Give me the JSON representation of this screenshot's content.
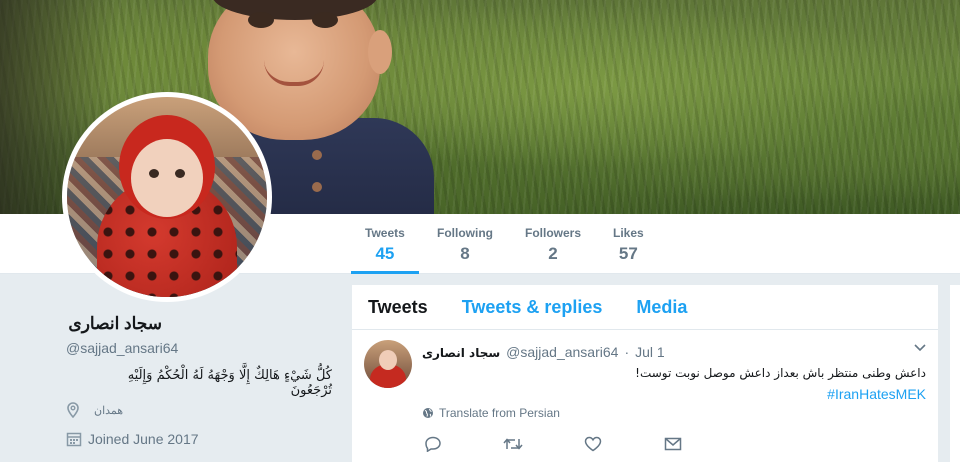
{
  "profile": {
    "name": "سجاد انصاری",
    "handle": "@sajjad_ansari64",
    "bio": "كُلُّ شَيْءٍ هَالِكٌ إِلَّا وَجْهَهُ لَهُ الْحُكْمُ وَإِلَيْهِ تُرْجَعُونَ",
    "location": "همدان",
    "joined": "Joined June 2017"
  },
  "stats": [
    {
      "label": "Tweets",
      "value": "45"
    },
    {
      "label": "Following",
      "value": "8"
    },
    {
      "label": "Followers",
      "value": "2"
    },
    {
      "label": "Likes",
      "value": "57"
    }
  ],
  "timeline": {
    "tabs": [
      "Tweets",
      "Tweets & replies",
      "Media"
    ]
  },
  "tweet": {
    "name": "سجاد انصاری",
    "handle": "@sajjad_ansari64",
    "dot": "·",
    "date": "Jul 1",
    "text": "داعش وطنی منتظر باش بعداز داعش موصل نوبت توست!",
    "hashtag": "#IranHatesMEK",
    "translate": "Translate from Persian"
  },
  "icons": {
    "location": "location-pin-icon",
    "calendar": "calendar-icon",
    "globe": "globe-icon",
    "reply": "reply-icon",
    "retweet": "retweet-icon",
    "like": "heart-icon",
    "dm": "envelope-icon",
    "caret": "chevron-down-icon"
  },
  "colors": {
    "accent": "#1da1f2",
    "muted": "#657786",
    "background": "#e6ecf0"
  }
}
